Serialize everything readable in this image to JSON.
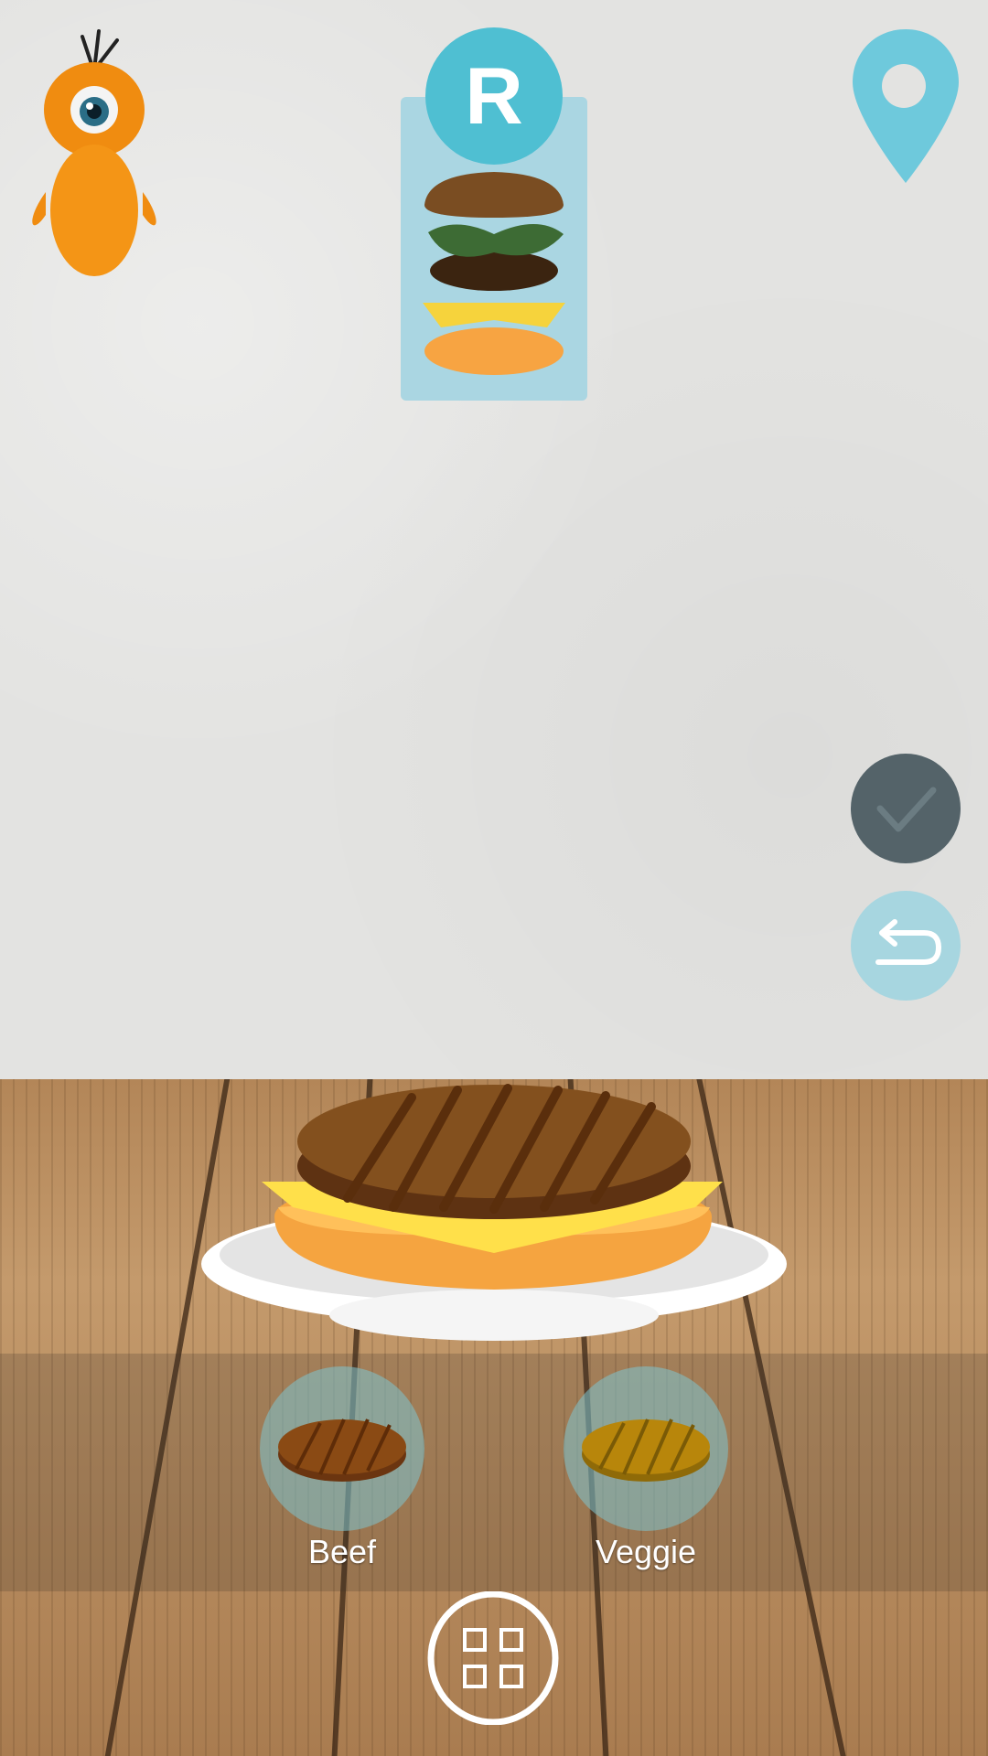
{
  "badge": {
    "letter": "R"
  },
  "ingredients": [
    {
      "label": "Beef",
      "icon": "beef-patty-icon",
      "color": "#8a4a14"
    },
    {
      "label": "Veggie",
      "icon": "veggie-patty-icon",
      "color": "#b8860b"
    }
  ],
  "colors": {
    "accent": "#4fbfd2",
    "confirm": "#546369",
    "undo": "#a7d6e0",
    "recipe_card": "#aad6e2"
  },
  "icons": {
    "mascot": "one-eyed-orange-creature-icon",
    "location": "location-pin-icon",
    "confirm": "checkmark-icon",
    "undo": "undo-arrow-icon",
    "menu": "grid-menu-icon"
  }
}
